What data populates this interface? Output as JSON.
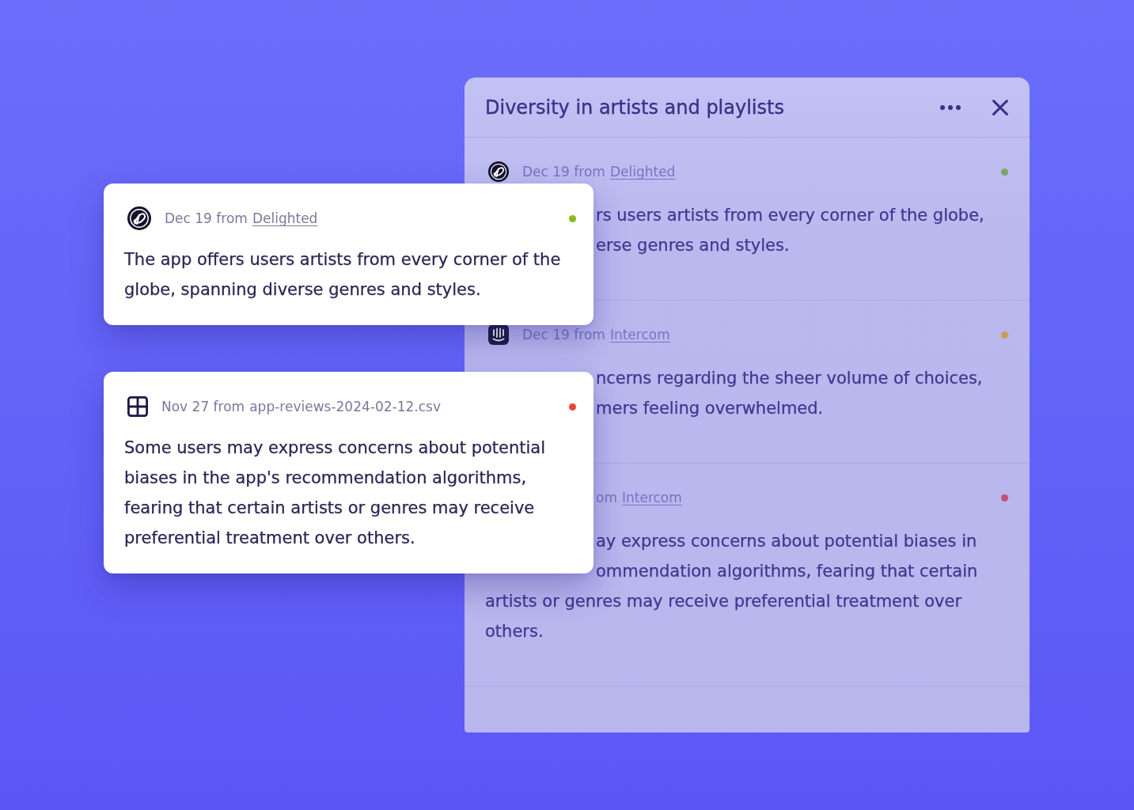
{
  "panel": {
    "title": "Diversity in artists and playlists",
    "items": [
      {
        "header": {
          "kind": "logo-circle",
          "text": "Dec 19 from",
          "source": "Delighted",
          "link": true,
          "covered": false
        },
        "color": "#7fa466",
        "partial_lines": [
          "rs users artists from every corner of the globe,",
          "erse genres and styles."
        ]
      },
      {
        "header": {
          "kind": "logo-bars",
          "text": "Dec 19 from",
          "source": "Intercom",
          "link": true,
          "covered": false
        },
        "color": "#c99d56",
        "partial_lines": [
          "ncerns regarding the sheer volume of choices,",
          "mers feeling overwhelmed."
        ]
      },
      {
        "header": {
          "text": "om",
          "source": "Intercom",
          "link": true,
          "covered": true
        },
        "color": "#c25070",
        "partial_lines": [
          "ay express concerns about potential biases in",
          "ommendation algorithms, fearing that certain"
        ],
        "lines": [
          "artists or genres may receive preferential treatment over",
          "others."
        ]
      }
    ]
  },
  "cards": [
    {
      "header": {
        "kind": "logo-circle",
        "text": "Dec 19 from",
        "source": "Delighted",
        "link": true
      },
      "color": "#8bbb1d",
      "text": "The app offers users artists from every corner of the globe, spanning diverse genres and styles."
    },
    {
      "header": {
        "kind": "table",
        "text": "Nov 27 from",
        "source": "app-reviews-2024-02-12.csv",
        "link": false
      },
      "color": "#e8472f",
      "text": "Some users may express concerns about potential biases in the app's recommendation algorithms, fearing that certain artists or genres may receive preferential treatment over others."
    }
  ]
}
